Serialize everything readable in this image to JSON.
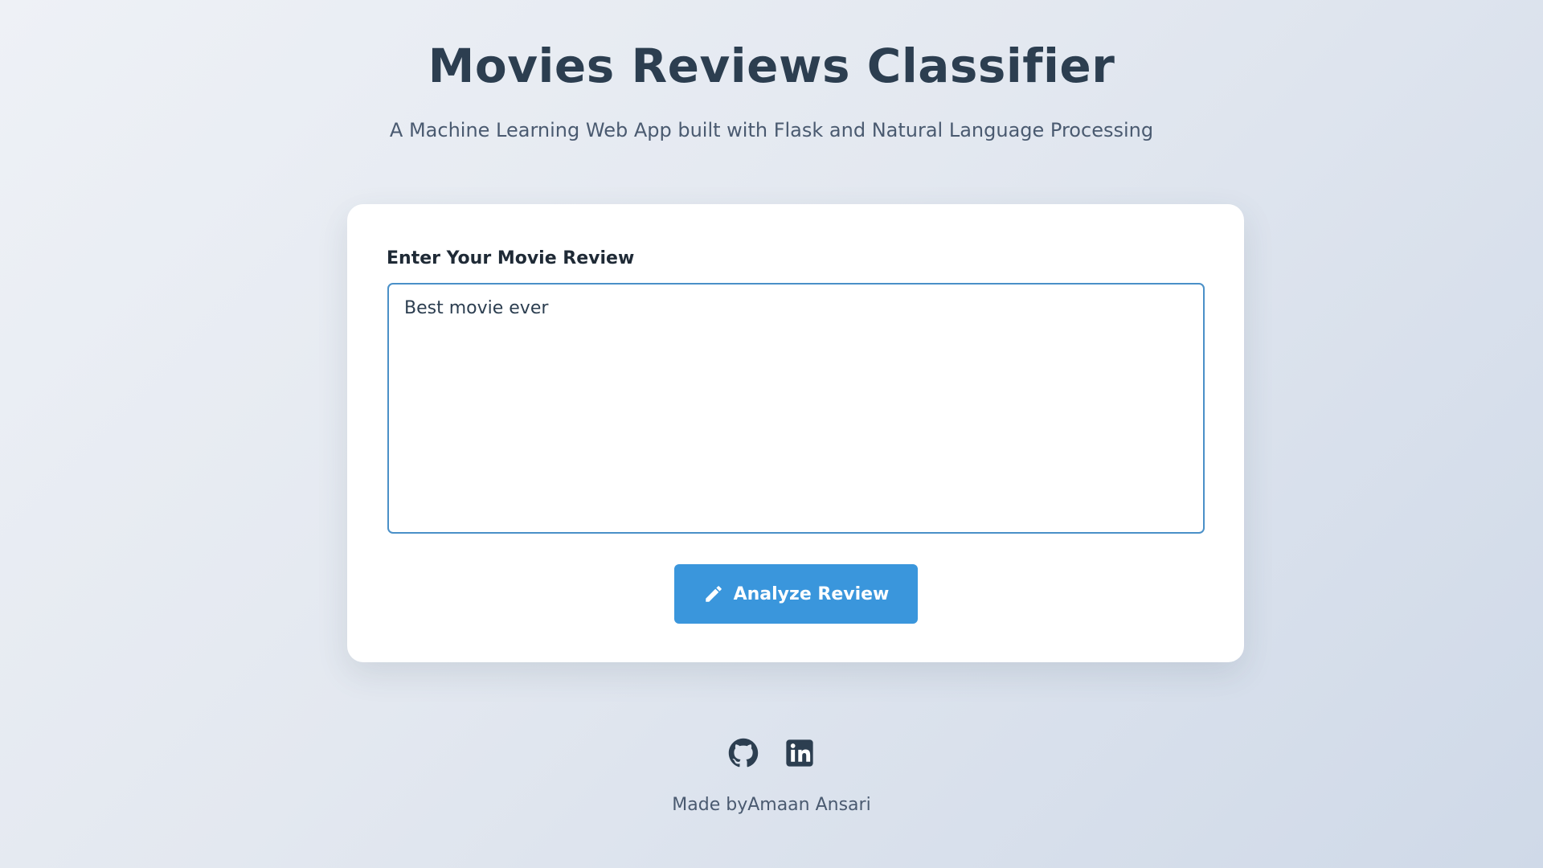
{
  "header": {
    "title": "Movies Reviews Classifier",
    "subtitle": "A Machine Learning Web App built with Flask and Natural Language Processing"
  },
  "form": {
    "label": "Enter Your Movie Review",
    "review_value": "Best movie ever",
    "button_label": "Analyze Review",
    "button_icon": "pencil-icon"
  },
  "footer": {
    "icons": [
      "github-icon",
      "linkedin-icon"
    ],
    "credit": "Made byAmaan Ansari"
  },
  "colors": {
    "primary": "#3a96dc",
    "input_border": "#4a90c8",
    "heading": "#2c3e50"
  }
}
